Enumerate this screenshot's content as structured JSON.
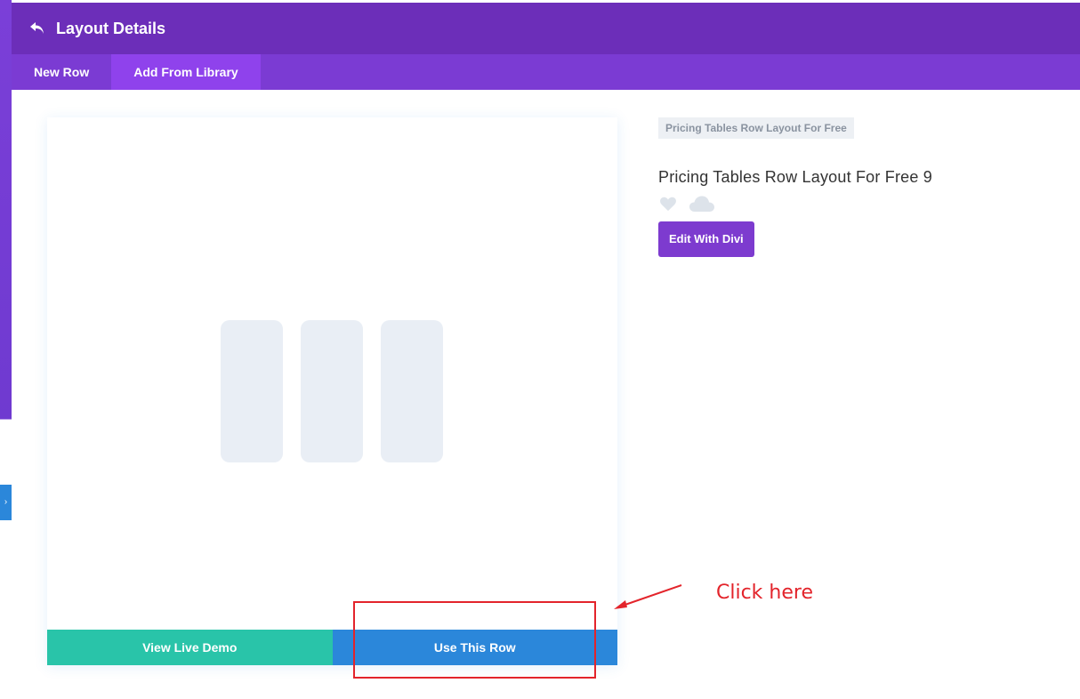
{
  "header": {
    "title": "Layout Details",
    "back_icon": "undo-arrow-icon",
    "color": "#6c2eb9"
  },
  "tabs": [
    {
      "label": "New Row",
      "active": false
    },
    {
      "label": "Add From Library",
      "active": true
    }
  ],
  "preview": {
    "view_demo_label": "View Live Demo",
    "use_row_label": "Use This Row",
    "demo_color": "#29c4a9",
    "use_color": "#2b87da"
  },
  "details": {
    "category": "Pricing Tables Row Layout For Free",
    "title": "Pricing Tables Row Layout For Free 9",
    "favorite_icon": "heart-icon",
    "cloud_icon": "cloud-icon",
    "edit_label": "Edit With Divi"
  },
  "annotation": {
    "text": "Click here",
    "color": "#e3242b"
  }
}
